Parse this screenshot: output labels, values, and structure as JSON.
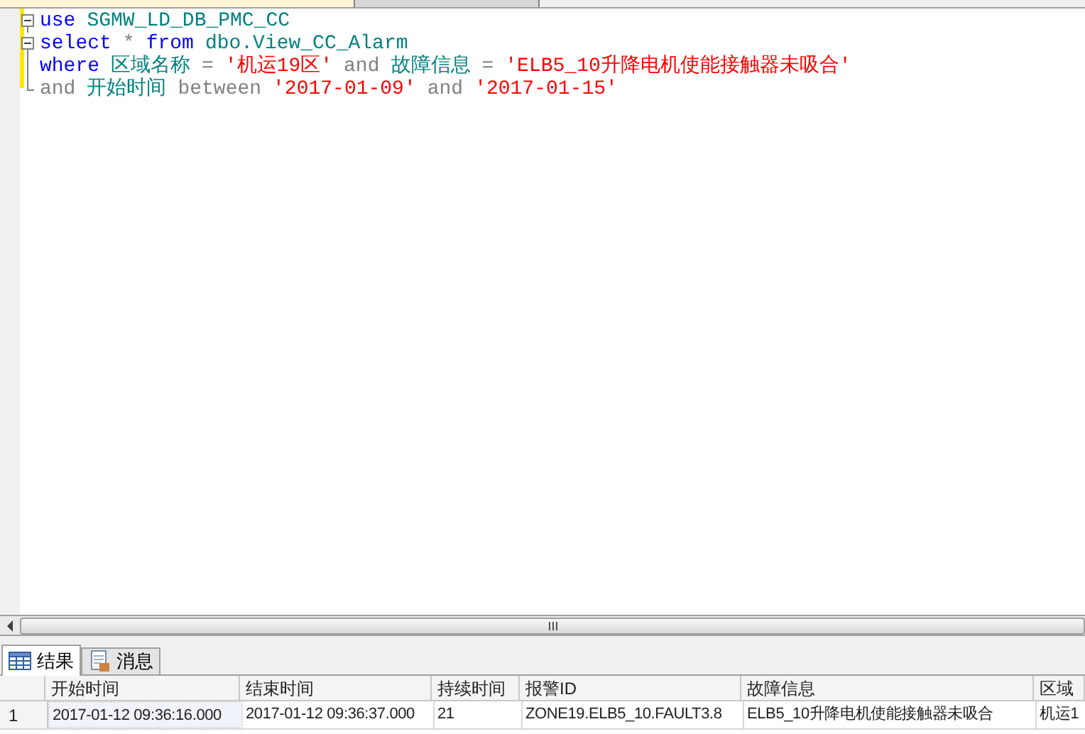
{
  "editor": {
    "lines": [
      {
        "collapsible": true,
        "tokens": [
          {
            "kind": "keyword",
            "text": "use"
          },
          {
            "kind": "ident",
            "text": "SGMW_LD_DB_PMC_CC"
          }
        ]
      },
      {
        "collapsible": true,
        "tokens": [
          {
            "kind": "keyword",
            "text": "select"
          },
          {
            "kind": "operator",
            "text": "*"
          },
          {
            "kind": "keyword",
            "text": "from"
          },
          {
            "kind": "ident",
            "text": "dbo.View_CC_Alarm"
          }
        ]
      },
      {
        "collapsible": false,
        "tokens": [
          {
            "kind": "keyword",
            "text": "where"
          },
          {
            "kind": "ident",
            "text": "区域名称"
          },
          {
            "kind": "operator",
            "text": "="
          },
          {
            "kind": "string",
            "text": "'机运19区'"
          },
          {
            "kind": "operator",
            "text": "and"
          },
          {
            "kind": "ident",
            "text": "故障信息"
          },
          {
            "kind": "operator",
            "text": "="
          },
          {
            "kind": "string",
            "text": "'ELB5_10升降电机使能接触器未吸合'"
          }
        ]
      },
      {
        "collapsible": false,
        "tokens": [
          {
            "kind": "operator",
            "text": "and"
          },
          {
            "kind": "ident",
            "text": "开始时间"
          },
          {
            "kind": "operator",
            "text": "between"
          },
          {
            "kind": "string",
            "text": "'2017-01-09'"
          },
          {
            "kind": "operator",
            "text": "and"
          },
          {
            "kind": "string",
            "text": "'2017-01-15'"
          }
        ]
      }
    ]
  },
  "result_tabs": [
    {
      "label": "结果",
      "kind": "grid",
      "selected": true
    },
    {
      "label": "消息",
      "kind": "messages",
      "selected": false
    }
  ],
  "grid": {
    "columns": [
      "开始时间",
      "结束时间",
      "持续时间",
      "报警ID",
      "故障信息",
      "区域"
    ],
    "rows": [
      {
        "number": "1",
        "cells": [
          "2017-01-12 09:36:16.000",
          "2017-01-12 09:36:37.000",
          "21",
          "ZONE19.ELB5_10.FAULT3.8",
          "ELB5_10升降电机使能接触器未吸合",
          "机运1"
        ]
      }
    ]
  }
}
